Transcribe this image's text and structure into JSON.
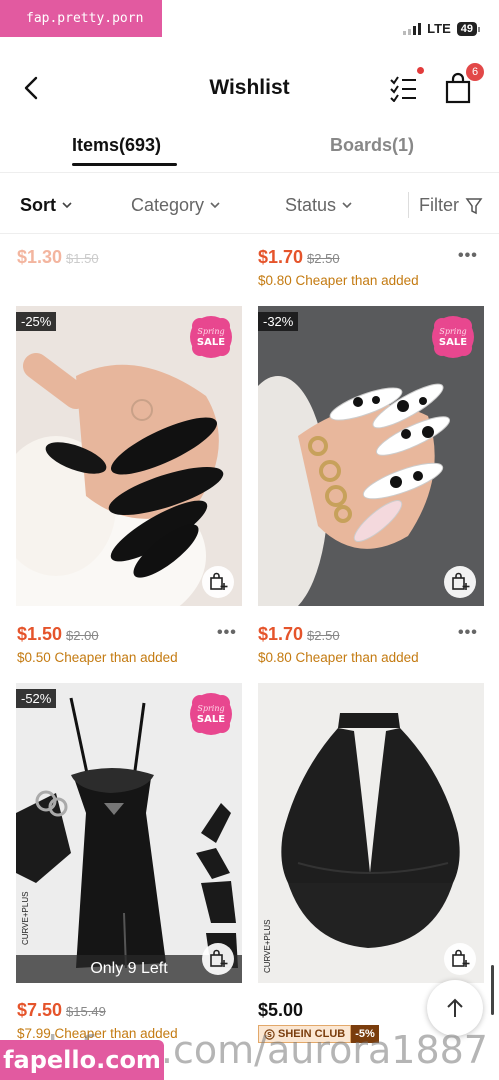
{
  "watermark_top": "fap.pretty.porn",
  "status": {
    "network": "LTE",
    "battery": "49"
  },
  "header": {
    "title": "Wishlist",
    "bag_count": "6"
  },
  "tabs": [
    {
      "label": "Items(693)",
      "active": true
    },
    {
      "label": "Boards(1)",
      "active": false
    }
  ],
  "filters": {
    "sort": "Sort",
    "category": "Category",
    "status": "Status",
    "filter": "Filter"
  },
  "products": [
    {
      "price": "$1.30",
      "original": "$1.50",
      "faded": true
    },
    {
      "price": "$1.70",
      "original": "$2.50",
      "cheaper": "$0.80 Cheaper than added"
    },
    {
      "discount": "-25%",
      "badge": "Spring SALE",
      "price": "$1.50",
      "original": "$2.00",
      "cheaper": "$0.50 Cheaper than added"
    },
    {
      "discount": "-32%",
      "badge": "Spring SALE",
      "price": "$1.70",
      "original": "$2.50",
      "cheaper": "$0.80 Cheaper than added"
    },
    {
      "discount": "-52%",
      "badge": "Spring SALE",
      "stock": "Only 9 Left",
      "brand": "CURVE+PLUS",
      "price": "$7.50",
      "original": "$15.49",
      "cheaper": "$7.99 Cheaper than added"
    },
    {
      "brand": "CURVE+PLUS",
      "price": "$5.00",
      "club_name": "SHEIN CLUB",
      "club_discount": "-5%"
    }
  ],
  "watermark_bottom": {
    "logo": "fapello.com",
    "text": "onlyfans.com/aurora1887"
  },
  "colors": {
    "accent_price": "#e5542b",
    "cheaper_text": "#c47b12",
    "sale_pink": "#e8478f",
    "watermark_pink": "#e25aa0"
  }
}
